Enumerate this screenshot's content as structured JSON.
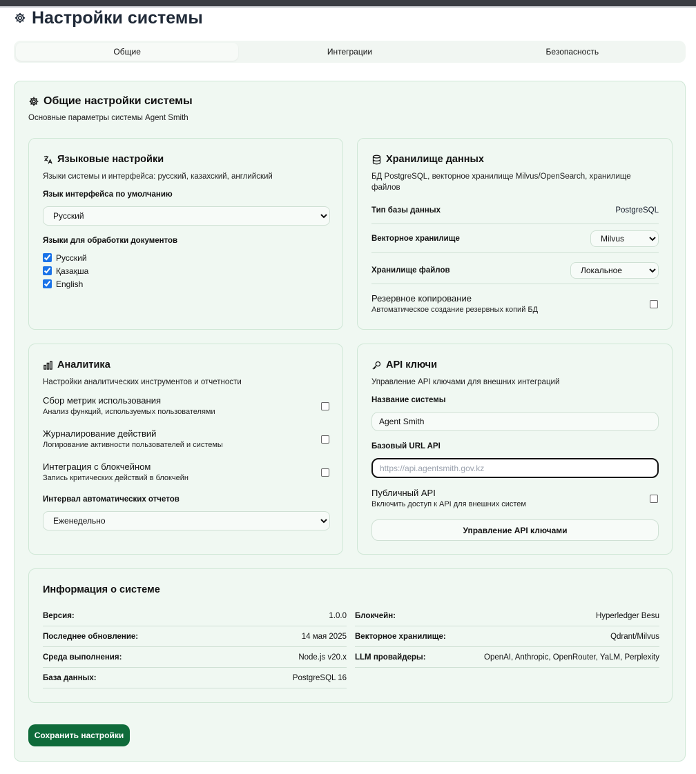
{
  "page": {
    "title": "Настройки системы"
  },
  "tabs": [
    {
      "label": "Общие"
    },
    {
      "label": "Интеграции"
    },
    {
      "label": "Безопасность"
    }
  ],
  "general": {
    "title": "Общие настройки системы",
    "description": "Основные параметры системы Agent Smith"
  },
  "language": {
    "title": "Языковые настройки",
    "description": "Языки системы и интерфейса: русский, казахский, английский",
    "default_label": "Язык интерфейса по умолчанию",
    "default_value": "Русский",
    "doc_label": "Языки для обработки документов",
    "doc_langs": [
      {
        "label": "Русский",
        "checked": true
      },
      {
        "label": "Қазақша",
        "checked": true
      },
      {
        "label": "English",
        "checked": true
      }
    ]
  },
  "storage": {
    "title": "Хранилище данных",
    "description": "БД PostgreSQL, векторное хранилище Milvus/OpenSearch, хранилище файлов",
    "db_type_label": "Тип базы данных",
    "db_type_value": "PostgreSQL",
    "vector_label": "Векторное хранилище",
    "vector_value": "Milvus",
    "files_label": "Хранилище файлов",
    "files_value": "Локальное",
    "backup_title": "Резервное копирование",
    "backup_desc": "Автоматическое создание резервных копий БД"
  },
  "analytics": {
    "title": "Аналитика",
    "description": "Настройки аналитических инструментов и отчетности",
    "toggles": [
      {
        "title": "Сбор метрик использования",
        "desc": "Анализ функций, используемых пользователями"
      },
      {
        "title": "Журналирование действий",
        "desc": "Логирование активности пользователей и системы"
      },
      {
        "title": "Интеграция с блокчейном",
        "desc": "Запись критических действий в блокчейн"
      }
    ],
    "interval_label": "Интервал автоматических отчетов",
    "interval_value": "Еженедельно"
  },
  "api": {
    "title": "API ключи",
    "description": "Управление API ключами для внешних интеграций",
    "system_name_label": "Название системы",
    "system_name_value": "Agent Smith",
    "base_url_label": "Базовый URL API",
    "base_url_placeholder": "https://api.agentsmith.gov.kz",
    "public_title": "Публичный API",
    "public_desc": "Включить доступ к API для внешних систем",
    "manage_button": "Управление API ключами"
  },
  "sysinfo": {
    "title": "Информация о системе",
    "left": [
      {
        "k": "Версия:",
        "v": "1.0.0"
      },
      {
        "k": "Последнее обновление:",
        "v": "14 мая 2025"
      },
      {
        "k": "Среда выполнения:",
        "v": "Node.js v20.x"
      },
      {
        "k": "База данных:",
        "v": "PostgreSQL 16"
      }
    ],
    "right": [
      {
        "k": "Блокчейн:",
        "v": "Hyperledger Besu"
      },
      {
        "k": "Векторное хранилище:",
        "v": "Qdrant/Milvus"
      },
      {
        "k": "LLM провайдеры:",
        "v": "OpenAI, Anthropic, OpenRouter, YaLM, Perplexity"
      }
    ]
  },
  "save_button": "Сохранить настройки",
  "colors": {
    "accent": "#0f6b3a",
    "card_bg": "#f0f8f2",
    "border": "#cfe7d6"
  }
}
